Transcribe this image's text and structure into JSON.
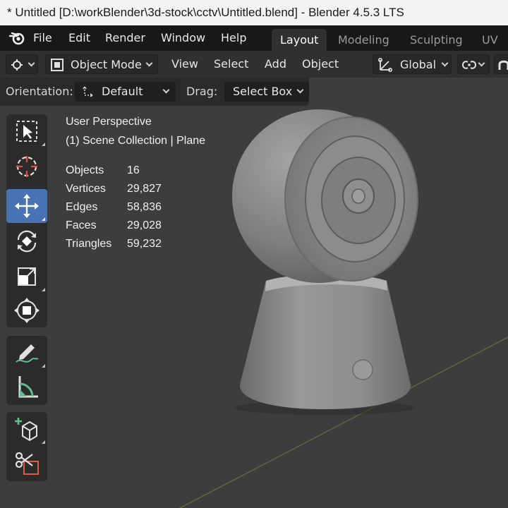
{
  "window": {
    "title": "* Untitled [D:\\workBlender\\3d-stock\\cctv\\Untitled.blend] - Blender 4.5.3 LTS"
  },
  "menu": {
    "items": [
      "File",
      "Edit",
      "Render",
      "Window",
      "Help"
    ]
  },
  "workspaces": {
    "tabs": [
      "Layout",
      "Modeling",
      "Sculpting",
      "UV E"
    ],
    "active": "Layout"
  },
  "header": {
    "mode": "Object Mode",
    "menus": [
      "View",
      "Select",
      "Add",
      "Object"
    ],
    "transform_orientation": "Global"
  },
  "tool_settings": {
    "orientation_label": "Orientation:",
    "orientation_value": "Default",
    "drag_label": "Drag:",
    "drag_value": "Select Box"
  },
  "viewport_overlay": {
    "view_name": "User Perspective",
    "collection_line": "(1) Scene Collection | Plane",
    "stats": [
      {
        "label": "Objects",
        "value": "16"
      },
      {
        "label": "Vertices",
        "value": "29,827"
      },
      {
        "label": "Edges",
        "value": "58,836"
      },
      {
        "label": "Faces",
        "value": "29,028"
      },
      {
        "label": "Triangles",
        "value": "59,232"
      }
    ]
  },
  "toolbar": {
    "tools": [
      "select-box-icon",
      "cursor-icon",
      "move-icon",
      "rotate-icon",
      "scale-icon",
      "transform-icon",
      "annotate-icon",
      "measure-icon",
      "add-cube-icon",
      "cut-icon"
    ],
    "active": "move-icon"
  },
  "colors": {
    "active_tool": "#4772b3",
    "viewport_bg": "#3d3d3d",
    "menubar_bg": "#181818",
    "header_bg": "#303030"
  }
}
